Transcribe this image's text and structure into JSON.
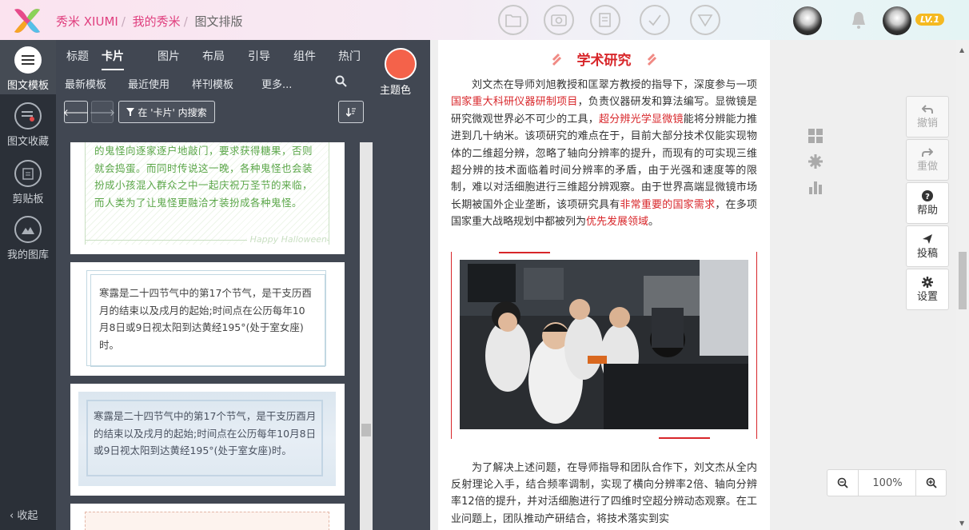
{
  "header": {
    "brand": "秀米 XIUMI",
    "breadcrumb_1": "我的秀米",
    "breadcrumb_2": "图文排版",
    "sep": "/",
    "level": "LV.1"
  },
  "left_nav": [
    {
      "label": "图文模板",
      "icon": "template-icon"
    },
    {
      "label": "图文收藏",
      "icon": "favorite-icon"
    },
    {
      "label": "剪贴板",
      "icon": "clipboard-icon"
    },
    {
      "label": "我的图库",
      "icon": "gallery-icon"
    }
  ],
  "collapse_label": "收起",
  "panel": {
    "tabs": [
      "标题",
      "卡片",
      "图片",
      "布局",
      "引导",
      "组件",
      "热门"
    ],
    "subtabs": [
      "最新模板",
      "最近使用",
      "样刊模板",
      "更多..."
    ],
    "theme_label": "主题色",
    "theme_color": "#f4624a",
    "search_button": "在 '卡片' 内搜索"
  },
  "cards": {
    "card1_text": "的鬼怪向逐家逐户地敲门，要求获得糖果，否则就会捣蛋。而同时传说这一晚，各种鬼怪也会装扮成小孩混入群众之中一起庆祝万圣节的来临，而人类为了让鬼怪更融洽才装扮成各种鬼怪。",
    "card1_footer": "Happy Halloween",
    "card2_text": "寒露是二十四节气中的第17个节气，是干支历酉月的结束以及戌月的起始;时间点在公历每年10月8日或9日视太阳到达黄经195°(处于室女座)时。",
    "card3_text": "寒露是二十四节气中的第17个节气，是干支历酉月的结束以及戌月的起始;时间点在公历每年10月8日或9日视太阳到达黄经195°(处于室女座)时。"
  },
  "article": {
    "heading": "学术研究",
    "p1_a": "刘文杰在导师刘旭教授和匡翠方教授的指导下，深度参与一项",
    "p1_r1": "国家重大科研仪器研制项目",
    "p1_b": "，负责仪器研发和算法编写。显微镜是研究微观世界必不可少的工具，",
    "p1_r2": "超分辨光学显微镜",
    "p1_c": "能将分辨能力推进到几十纳米。该项研究的难点在于，目前大部分技术仅能实现物体的二维超分辨，忽略了轴向分辨率的提升，而现有的可实现三维超分辨的技术面临着时间分辨率的矛盾，由于光强和速度等的限制，难以对活细胞进行三维超分辨观察。由于世界高端显微镜市场长期被国外企业垄断，该项研究具有",
    "p1_r3": "非常重要的国家需求",
    "p1_d": "，在多项国家重大战略规划中都被列为",
    "p1_r4": "优先发展领域",
    "p1_e": "。",
    "p2": "为了解决上述问题，在导师指导和团队合作下，刘文杰从全内反射理论入手，结合频率调制，实现了横向分辨率2倍、轴向分辨率12倍的提升，并对活细胞进行了四维时空超分辨动态观察。在工业问题上，团队推动产研结合，将技术落实到实"
  },
  "tools": {
    "undo": "撤销",
    "redo": "重做",
    "help": "帮助",
    "submit": "投稿",
    "settings": "设置"
  },
  "zoom": "100%",
  "accent": "#d8262a"
}
